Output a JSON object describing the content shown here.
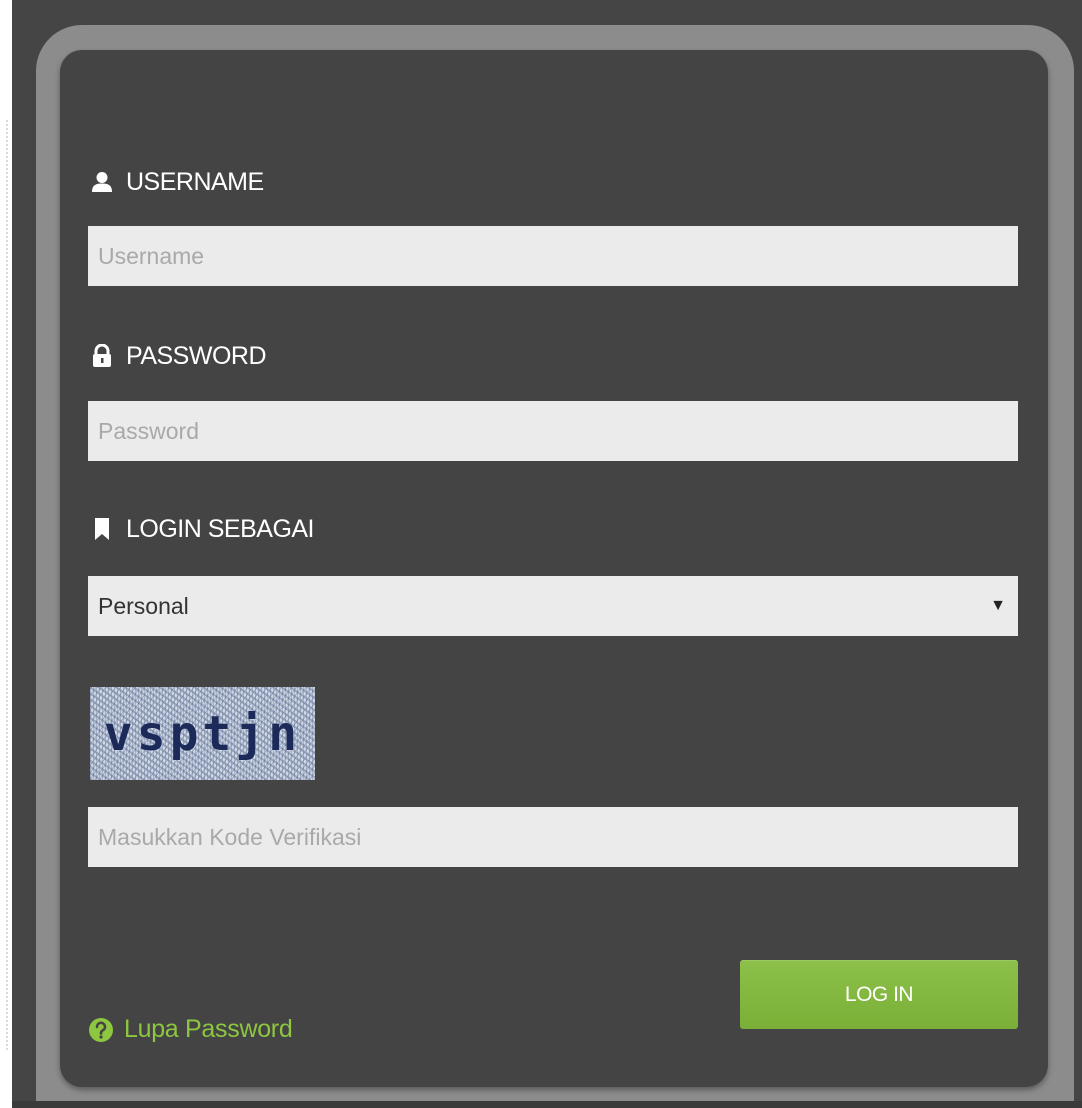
{
  "form": {
    "username_label": "USERNAME",
    "username_placeholder": "Username",
    "password_label": "PASSWORD",
    "password_placeholder": "Password",
    "role_label": "LOGIN SEBAGAI",
    "role_selected": "Personal",
    "captcha_text": "vsptjn",
    "captcha_placeholder": "Masukkan Kode Verifikasi",
    "forgot_label": "Lupa Password",
    "login_label": "LOG IN"
  },
  "icons": {
    "username": "user-icon",
    "password": "lock-icon",
    "role": "bookmark-icon",
    "forgot": "question-circle-icon",
    "select": "caret-down-icon"
  },
  "colors": {
    "background": "#454545",
    "frame": "#8c8c8c",
    "panel": "#444444",
    "input": "#ebebeb",
    "accent": "#8dc63f",
    "button": "#7ab037"
  }
}
